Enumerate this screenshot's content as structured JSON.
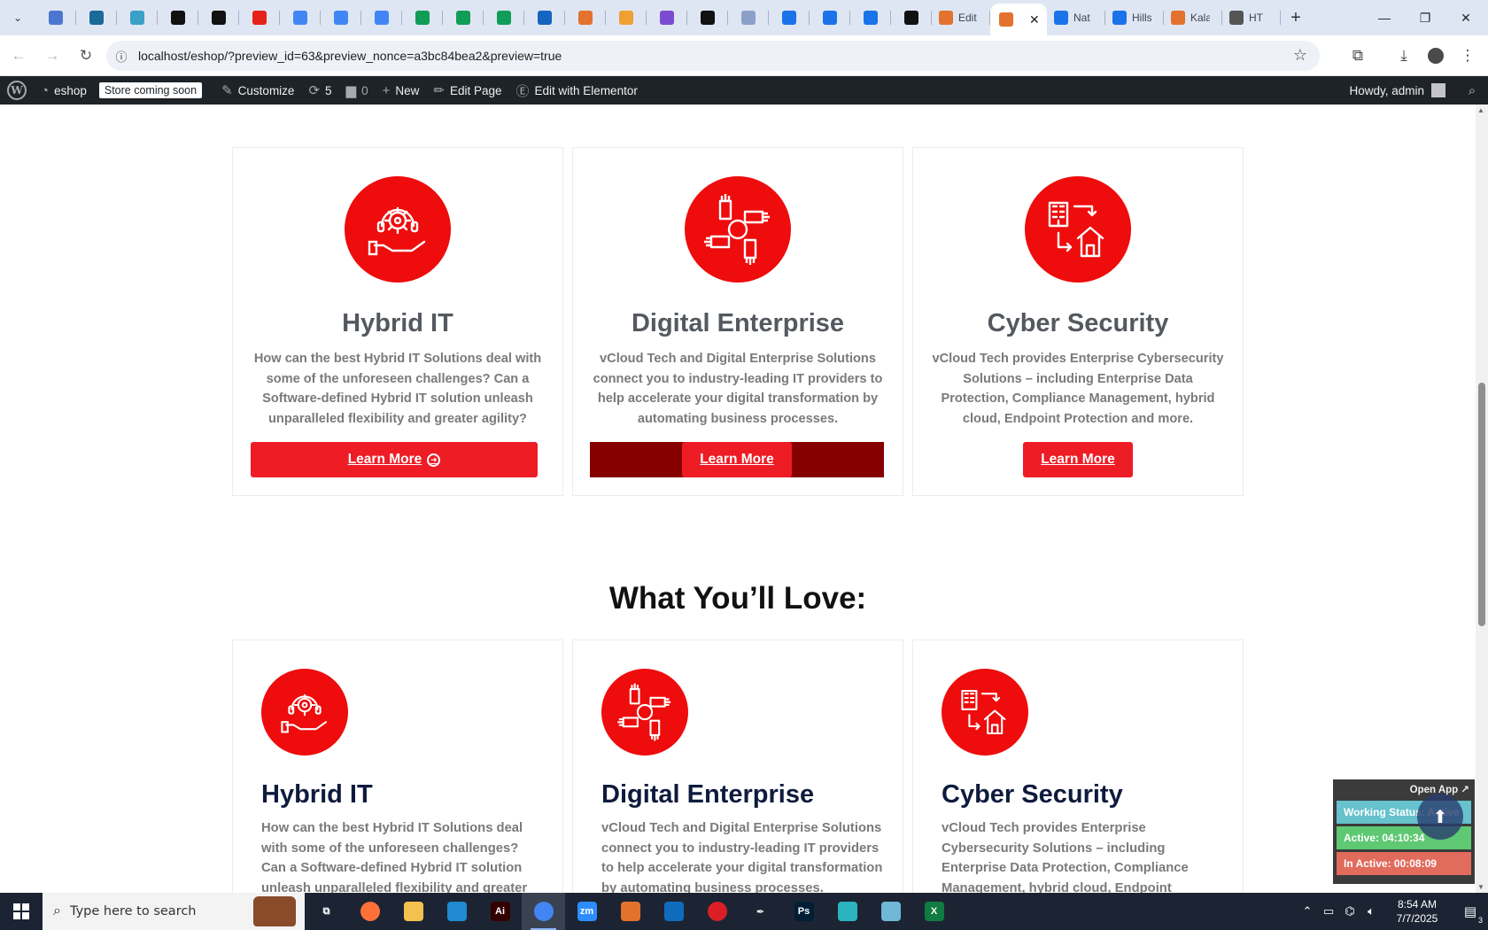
{
  "browser": {
    "tabs": [
      {
        "icon": "globe-icon",
        "color": "#4b77d1"
      },
      {
        "icon": "vpn-icon",
        "color": "#1a6a9a"
      },
      {
        "icon": "dev-icon",
        "color": "#3aa0c8"
      },
      {
        "icon": "openai-icon",
        "color": "#111111"
      },
      {
        "icon": "bolt-icon",
        "color": "#111111"
      },
      {
        "icon": "youtube-icon",
        "color": "#e62117"
      },
      {
        "icon": "docs-icon",
        "color": "#4285f4"
      },
      {
        "icon": "docs-icon",
        "color": "#4285f4"
      },
      {
        "icon": "docs-icon",
        "color": "#4285f4"
      },
      {
        "icon": "sheets-icon",
        "color": "#0f9d58"
      },
      {
        "icon": "sheets-icon",
        "color": "#0f9d58"
      },
      {
        "icon": "sheets-icon",
        "color": "#0f9d58"
      },
      {
        "icon": "tool-icon",
        "color": "#1565c0"
      },
      {
        "icon": "xampp-icon",
        "color": "#e2722d"
      },
      {
        "icon": "ribbon-icon",
        "color": "#f0a030"
      },
      {
        "icon": "code-icon",
        "color": "#7b4bd1"
      },
      {
        "icon": "lambda-icon",
        "color": "#111111"
      },
      {
        "icon": "grid-icon",
        "color": "#8aa0c8"
      },
      {
        "icon": "forms-icon",
        "color": "#1a73e8"
      },
      {
        "icon": "forms-icon",
        "color": "#1a73e8"
      },
      {
        "icon": "forms-icon",
        "color": "#1a73e8"
      },
      {
        "icon": "medium-icon",
        "color": "#111111"
      }
    ],
    "labeled_tabs_before": [
      {
        "label": "Edit",
        "icon": "xampp-icon",
        "color": "#e2722d"
      }
    ],
    "active_tab": {
      "icon": "xampp-icon",
      "color": "#e2722d"
    },
    "labeled_tabs_after": [
      {
        "label": "Nat",
        "icon": "forms-icon",
        "color": "#1a73e8"
      },
      {
        "label": "Hills",
        "icon": "forms-icon",
        "color": "#1a73e8"
      },
      {
        "label": "Kala",
        "icon": "flame-icon",
        "color": "#e2722d"
      },
      {
        "label": "HT",
        "icon": "globe-icon",
        "color": "#555555"
      }
    ],
    "url": "localhost/eshop/?preview_id=63&preview_nonce=a3bc84bea2&preview=true"
  },
  "wpbar": {
    "site": "eshop",
    "store_badge": "Store coming soon",
    "customize": "Customize",
    "updates": "5",
    "comments": "0",
    "new": "New",
    "edit_page": "Edit Page",
    "elementor": "Edit with Elementor",
    "howdy": "Howdy, admin"
  },
  "services": [
    {
      "title": "Hybrid IT",
      "text": "How can the best Hybrid IT Solutions deal with some of the unforeseen challenges? Can a Software-defined Hybrid IT solution unleash unparalleled flexibility and greater agility?",
      "button": "Learn More"
    },
    {
      "title": "Digital Enterprise",
      "text": "vCloud Tech and Digital Enterprise Solutions connect you to industry-leading IT providers to help accelerate your digital transformation by automating business processes.",
      "button": "Learn More"
    },
    {
      "title": "Cyber Security",
      "text": "vCloud Tech provides Enterprise Cybersecurity Solutions – including Enterprise Data Protection, Compliance Management, hybrid cloud, Endpoint Protection and more.",
      "button": "Learn More"
    }
  ],
  "section_heading": "What You’ll Love:",
  "features": [
    {
      "title": "Hybrid IT",
      "text": "How can the best Hybrid IT Solutions deal with some of the unforeseen challenges? Can a Software-defined Hybrid IT solution unleash unparalleled flexibility and greater agility?"
    },
    {
      "title": "Digital Enterprise",
      "text": "vCloud Tech and Digital Enterprise Solutions connect you to industry-leading IT providers to help accelerate your digital transformation by automating business processes."
    },
    {
      "title": "Cyber Security",
      "text": "vCloud Tech provides Enterprise Cybersecurity Solutions – including Enterprise Data Protection, Compliance Management, hybrid cloud, Endpoint Protection and more."
    }
  ],
  "tracker": {
    "open_app": "Open App ↗",
    "working_status": "Working Status: Active",
    "active": "Active: 04:10:34",
    "inactive": "In Active: 00:08:09"
  },
  "taskbar": {
    "search_placeholder": "Type here to search",
    "apps": [
      {
        "icon": "task-view-icon",
        "color": "#1c2433",
        "glyph": "⧉"
      },
      {
        "icon": "firefox-icon",
        "color": "#ff7139",
        "glyph": ""
      },
      {
        "icon": "file-explorer-icon",
        "color": "#f2c14e",
        "glyph": ""
      },
      {
        "icon": "vscode-icon",
        "color": "#1f8ad2",
        "glyph": ""
      },
      {
        "icon": "illustrator-icon",
        "color": "#330000",
        "glyph": "Ai"
      },
      {
        "icon": "chrome-icon",
        "color": "#4285f4",
        "glyph": ""
      },
      {
        "icon": "zoom-icon",
        "color": "#2d8cff",
        "glyph": "zm"
      },
      {
        "icon": "xampp-icon",
        "color": "#e2722d",
        "glyph": ""
      },
      {
        "icon": "outlook-icon",
        "color": "#0f6cbd",
        "glyph": ""
      },
      {
        "icon": "creative-cloud-icon",
        "color": "#da1f26",
        "glyph": ""
      },
      {
        "icon": "pen-tool-icon",
        "color": "#1c2433",
        "glyph": "✒"
      },
      {
        "icon": "photoshop-icon",
        "color": "#001e36",
        "glyph": "Ps"
      },
      {
        "icon": "app-icon",
        "color": "#2bb3c0",
        "glyph": ""
      },
      {
        "icon": "notepad-icon",
        "color": "#6fb7d6",
        "glyph": ""
      },
      {
        "icon": "excel-icon",
        "color": "#107c41",
        "glyph": "X"
      }
    ],
    "time": "8:54 AM",
    "date": "7/7/2025",
    "notifications": "3"
  }
}
